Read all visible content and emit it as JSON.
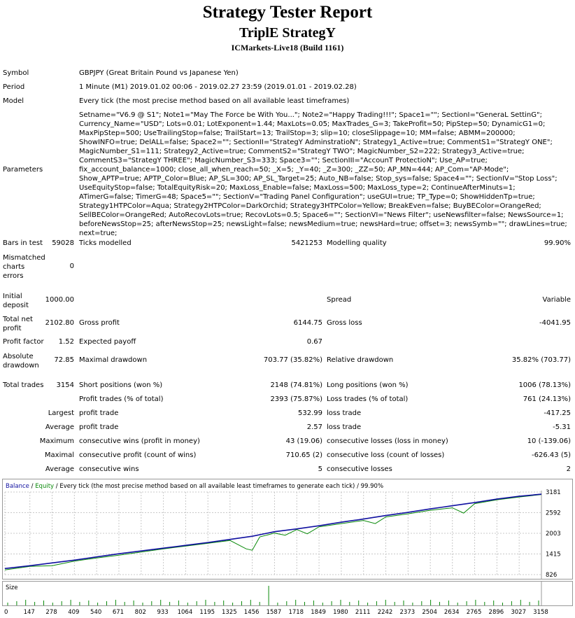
{
  "header": {
    "title": "Strategy Tester Report",
    "subtitle": "TriplE StrategY",
    "server": "ICMarkets-Live18 (Build 1161)"
  },
  "info": {
    "symbol_label": "Symbol",
    "symbol_value": "GBPJPY (Great Britain Pound vs Japanese Yen)",
    "period_label": "Period",
    "period_value": "1 Minute (M1) 2019.01.02 00:06 - 2019.02.27 23:59 (2019.01.01 - 2019.02.28)",
    "model_label": "Model",
    "model_value": "Every tick (the most precise method based on all available least timeframes)",
    "parameters_label": "Parameters",
    "parameters_value": "Setname=\"V6.9 @ S1\"; Note1=\"May The Force be With You...\"; Note2=\"Happy Trading!!!\"; Space1=\"\"; SectionI=\"GeneraL SettinG\"; Currency_Name=\"USD\"; Lots=0.01; LotExponent=1.44; MaxLots=0.05; MaxTrades_G=3; TakeProfit=50; PipStep=50; DynamicG1=0; MaxPipStep=500; UseTrailingStop=false; TrailStart=13; TrailStop=3; slip=10; closeSlippage=10; MM=false; ABMM=200000; ShowINFO=true; DelALL=false; Space2=\"\"; SectionII=\"StrategY AdminstratioN\"; Strategy1_Active=true; CommentS1=\"StrategY ONE\"; MagicNumber_S1=111; Strategy2_Active=true; CommentS2=\"StrategY TWO\"; MagicNumber_S2=222; Strategy3_Active=true; CommentS3=\"StrategY THREE\"; MagicNumber_S3=333; Space3=\"\"; SectionIII=\"AccounT ProtectioN\"; Use_AP=true; fix_account_balance=1000; close_all_when_reach=50; _X=5; _Y=40; _Z=300; _ZZ=50; AP_MN=444; AP_Com=\"AP-Mode\"; Show_APTP=true; APTP_Color=Blue; AP_SL=300; AP_SL_Target=25; Auto_NB=false; Stop_sys=false; Space4=\"\"; SectionIV=\"Stop Loss\"; UseEquityStop=false; TotalEquityRisk=20; MaxLoss_Enable=false; MaxLoss=500; MaxLoss_type=2; ContinueAfterMinuts=1; ATimerG=false; TimerG=48; Space5=\"\"; SectionV=\"Trading Panel Configuration\"; useGUI=true; TP_Type=0; ShowHiddenTp=true; Strategy1HTPColor=Aqua; Strategy2HTPColor=DarkOrchid; Strategy3HTPColor=Yellow; BreakEven=false; BuyBEColor=OrangeRed; SellBEColor=OrangeRed; AutoRecovLots=true; RecovLots=0.5; Space6=\"\"; SectionVI=\"News Filter\"; useNewsfilter=false; NewsSource=1; beforeNewsStop=25; afterNewsStop=25; newsLight=false; newsMedium=true; newsHard=true; offset=3; newsSymb=\"\"; drawLines=true; next=true;"
  },
  "stats": {
    "bars_label": "Bars in test",
    "bars_value": "59028",
    "ticks_label": "Ticks modelled",
    "ticks_value": "5421253",
    "quality_label": "Modelling quality",
    "quality_value": "99.90%",
    "mismatch_label": "Mismatched charts errors",
    "mismatch_value": "0",
    "deposit_label": "Initial deposit",
    "deposit_value": "1000.00",
    "spread_label": "Spread",
    "spread_value": "Variable",
    "netprofit_label": "Total net profit",
    "netprofit_value": "2102.80",
    "grossprofit_label": "Gross profit",
    "grossprofit_value": "6144.75",
    "grossloss_label": "Gross loss",
    "grossloss_value": "-4041.95",
    "pf_label": "Profit factor",
    "pf_value": "1.52",
    "ep_label": "Expected payoff",
    "ep_value": "0.67",
    "absdd_label": "Absolute drawdown",
    "absdd_value": "72.85",
    "maxdd_label": "Maximal drawdown",
    "maxdd_value": "703.77 (35.82%)",
    "reldd_label": "Relative drawdown",
    "reldd_value": "35.82% (703.77)",
    "trades_label": "Total trades",
    "trades_value": "3154",
    "short_label": "Short positions (won %)",
    "short_value": "2148 (74.81%)",
    "long_label": "Long positions (won %)",
    "long_value": "1006 (78.13%)",
    "pt_label": "Profit trades (% of total)",
    "pt_value": "2393 (75.87%)",
    "lt_label": "Loss trades (% of total)",
    "lt_value": "761 (24.13%)",
    "largest_label": "Largest",
    "largest_profit_label": "profit trade",
    "largest_profit_value": "532.99",
    "largest_loss_label": "loss trade",
    "largest_loss_value": "-417.25",
    "average_label": "Average",
    "average_profit_label": "profit trade",
    "average_profit_value": "2.57",
    "average_loss_label": "loss trade",
    "average_loss_value": "-5.31",
    "maximum_label": "Maximum",
    "max_wins_label": "consecutive wins (profit in money)",
    "max_wins_value": "43 (19.06)",
    "max_losses_label": "consecutive losses (loss in money)",
    "max_losses_value": "10 (-139.06)",
    "maximal_label": "Maximal",
    "maximal_profit_label": "consecutive profit (count of wins)",
    "maximal_profit_value": "710.65 (2)",
    "maximal_loss_label": "consecutive loss (count of losses)",
    "maximal_loss_value": "-626.43 (5)",
    "avg2_label": "Average",
    "avg_wins_label": "consecutive wins",
    "avg_wins_value": "5",
    "avg_losses_label": "consecutive losses",
    "avg_losses_value": "2"
  },
  "chart_legend": {
    "balance": "Balance",
    "sep1": " / ",
    "equity": "Equity",
    "rest": " / Every tick (the most precise method based on all available least timeframes to generate each tick) / 99.90%"
  },
  "size_label": "Size",
  "chart_data": {
    "type": "line",
    "title": "",
    "y_ticks": [
      "3181",
      "2592",
      "2003",
      "1415",
      "826"
    ],
    "x_ticks": [
      "0",
      "147",
      "278",
      "409",
      "540",
      "671",
      "802",
      "933",
      "1064",
      "1195",
      "1325",
      "1456",
      "1587",
      "1718",
      "1849",
      "1980",
      "2111",
      "2242",
      "2373",
      "2504",
      "2634",
      "2765",
      "2896",
      "3027",
      "3158"
    ],
    "ylim": [
      826,
      3181
    ],
    "xlim": [
      0,
      3158
    ],
    "series": [
      {
        "name": "Balance",
        "color": "#1010a0",
        "x": [
          0,
          147,
          278,
          409,
          540,
          671,
          802,
          933,
          1064,
          1195,
          1325,
          1456,
          1587,
          1718,
          1849,
          1980,
          2111,
          2242,
          2373,
          2504,
          2634,
          2765,
          2896,
          3027,
          3158
        ],
        "y": [
          1000,
          1080,
          1160,
          1240,
          1330,
          1420,
          1500,
          1580,
          1660,
          1740,
          1830,
          1920,
          2050,
          2130,
          2220,
          2320,
          2410,
          2510,
          2600,
          2700,
          2790,
          2880,
          2980,
          3060,
          3120
        ]
      },
      {
        "name": "Equity",
        "color": "#0a8a0a",
        "x": [
          0,
          147,
          278,
          409,
          540,
          671,
          802,
          933,
          1064,
          1195,
          1325,
          1420,
          1456,
          1500,
          1587,
          1650,
          1718,
          1780,
          1849,
          1980,
          2111,
          2180,
          2242,
          2373,
          2504,
          2634,
          2700,
          2765,
          2896,
          3027,
          3158
        ],
        "y": [
          960,
          1060,
          1080,
          1210,
          1300,
          1380,
          1470,
          1560,
          1640,
          1720,
          1800,
          1560,
          1520,
          1900,
          2010,
          1950,
          2110,
          1990,
          2190,
          2280,
          2370,
          2280,
          2470,
          2560,
          2660,
          2730,
          2580,
          2850,
          2960,
          3040,
          3110
        ]
      }
    ]
  },
  "colors": {
    "balance": "#1010a0",
    "equity": "#0a8a0a",
    "size_bars": "#0a8a0a"
  }
}
